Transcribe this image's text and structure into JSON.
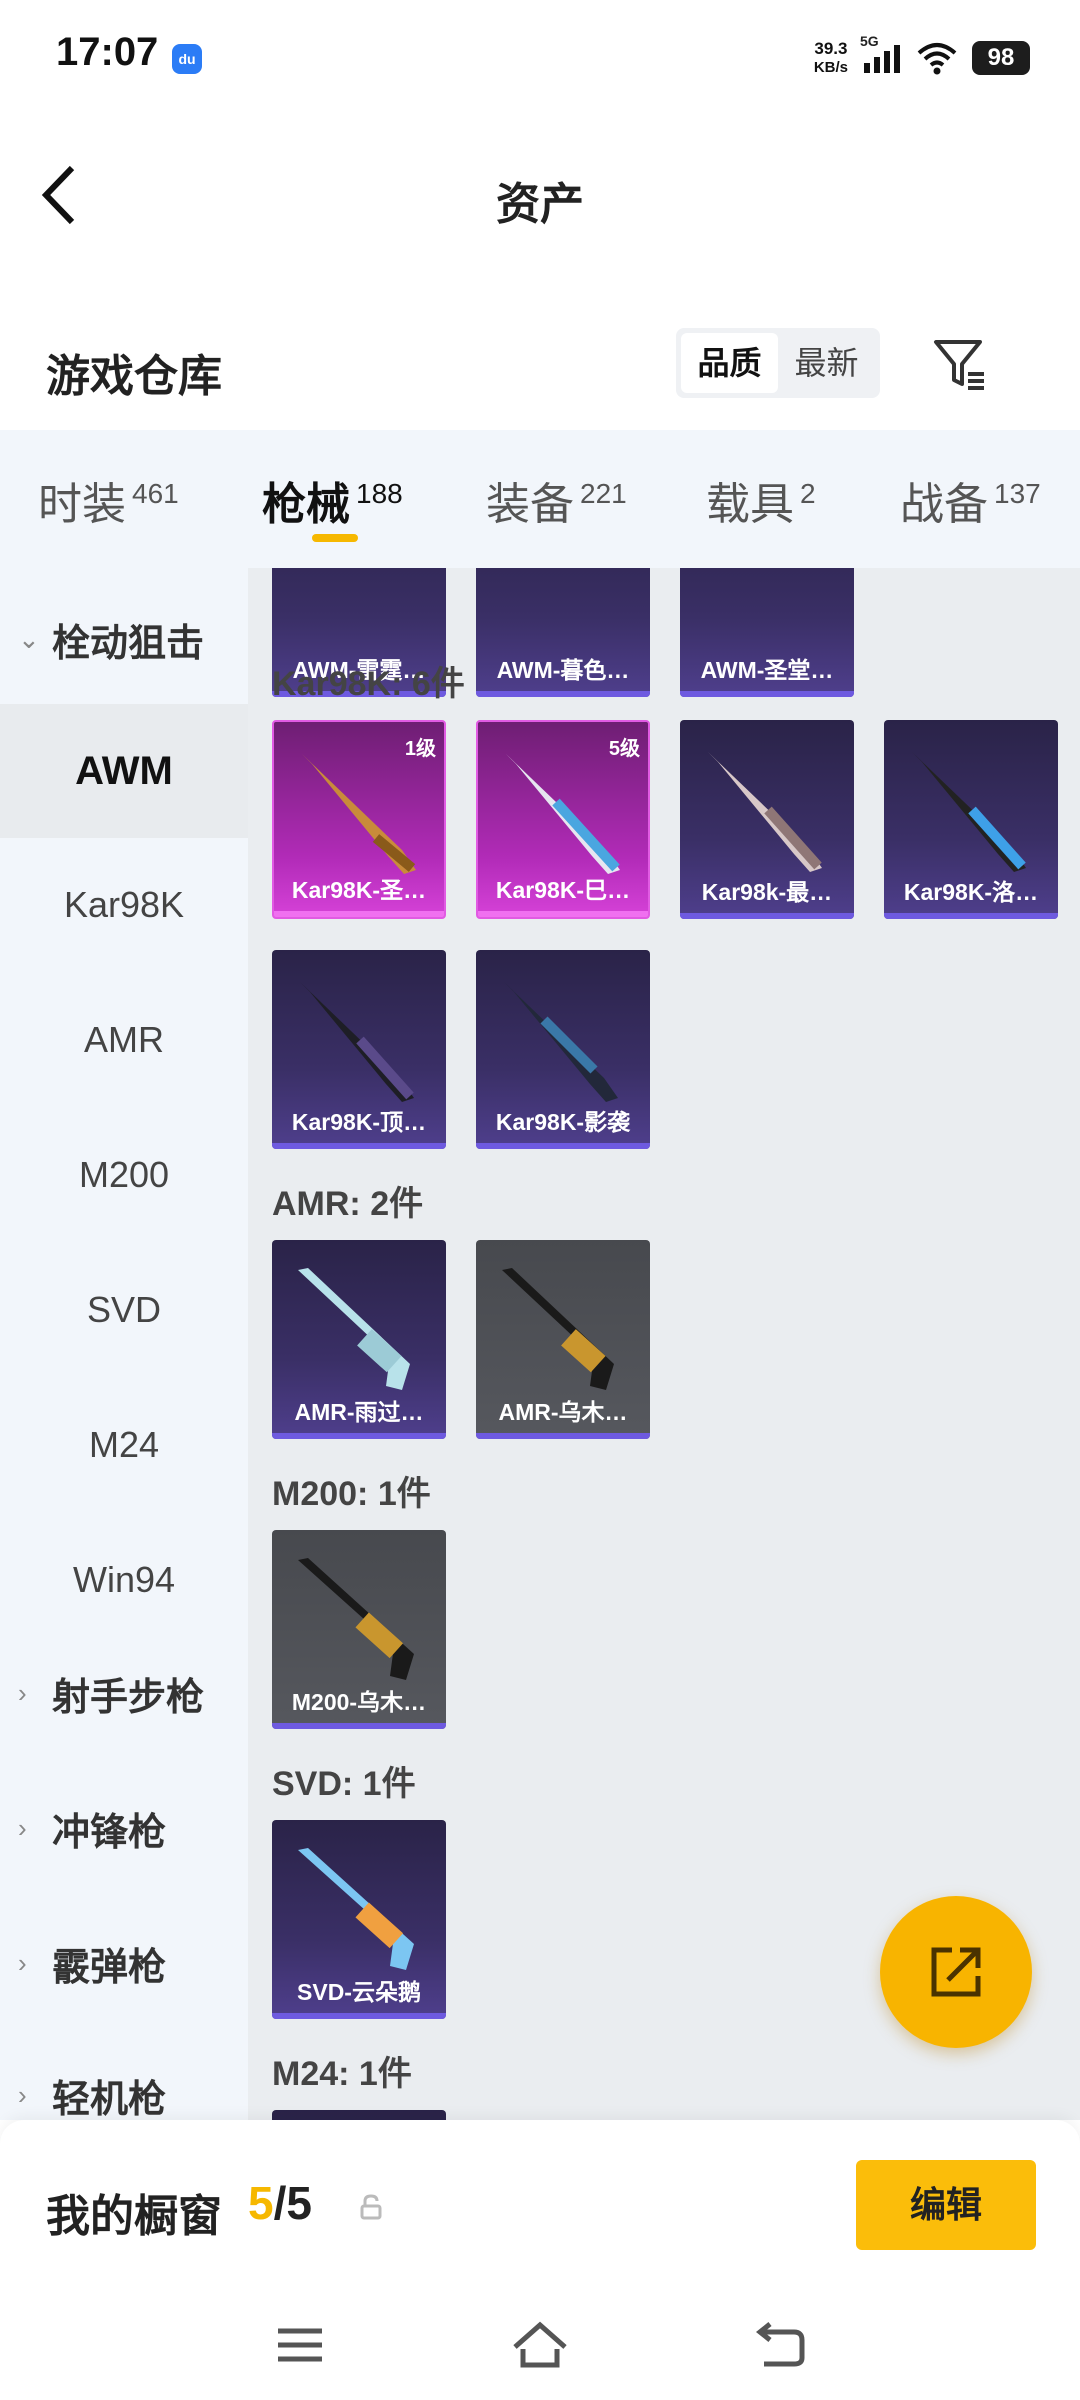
{
  "status_bar": {
    "time": "17:07",
    "app_icon_text": "du",
    "net_speed": "39.3",
    "net_unit": "KB/s",
    "network": "5G",
    "battery": "98"
  },
  "header": {
    "title": "资产"
  },
  "warehouse": {
    "title": "游戏仓库",
    "sort_options": [
      "品质",
      "最新"
    ],
    "sort_selected": "品质"
  },
  "tabs": [
    {
      "label": "时装",
      "count": "461"
    },
    {
      "label": "枪械",
      "count": "188"
    },
    {
      "label": "装备",
      "count": "221"
    },
    {
      "label": "载具",
      "count": "2"
    },
    {
      "label": "战备",
      "count": "137"
    }
  ],
  "sidebar": {
    "groups": [
      {
        "label": "栓动狙击",
        "expanded": true
      },
      {
        "label": "射手步枪",
        "expanded": false
      },
      {
        "label": "冲锋枪",
        "expanded": false
      },
      {
        "label": "霰弹枪",
        "expanded": false
      },
      {
        "label": "轻机枪",
        "expanded": false
      }
    ],
    "sub_items": [
      "AWM",
      "Kar98K",
      "AMR",
      "M200",
      "SVD",
      "M24",
      "Win94"
    ],
    "active_sub_item": "AWM"
  },
  "content": {
    "top_cards": [
      "AWM-雷霆…",
      "AWM-暮色…",
      "AWM-圣堂…"
    ],
    "sections": [
      {
        "label": "Kar98K: 6件",
        "cards": [
          {
            "name": "Kar98K-圣…",
            "level": "1级",
            "color": "pink"
          },
          {
            "name": "Kar98K-巳…",
            "level": "5级",
            "color": "pink"
          },
          {
            "name": "Kar98k-最…",
            "level": "",
            "color": "purple"
          },
          {
            "name": "Kar98K-洛…",
            "level": "",
            "color": "purple"
          },
          {
            "name": "Kar98K-顶…",
            "level": "",
            "color": "purple"
          },
          {
            "name": "Kar98K-影袭",
            "level": "",
            "color": "purple"
          }
        ]
      },
      {
        "label": "AMR: 2件",
        "cards": [
          {
            "name": "AMR-雨过…",
            "level": "",
            "color": "purple"
          },
          {
            "name": "AMR-乌木…",
            "level": "",
            "color": "grey"
          }
        ]
      },
      {
        "label": "M200: 1件",
        "cards": [
          {
            "name": "M200-乌木…",
            "level": "",
            "color": "grey"
          }
        ]
      },
      {
        "label": "SVD: 1件",
        "cards": [
          {
            "name": "SVD-云朵鹅",
            "level": "",
            "color": "purple"
          }
        ]
      },
      {
        "label": "M24: 1件",
        "cards": []
      }
    ]
  },
  "showcase": {
    "title": "我的橱窗",
    "count_current": "5",
    "count_total": "/5",
    "edit_label": "编辑"
  },
  "colors": {
    "accent": "#f6b800",
    "rare_pink": "#c22fc7",
    "epic_purple": "#3a2f66",
    "common_grey": "#52545a"
  }
}
